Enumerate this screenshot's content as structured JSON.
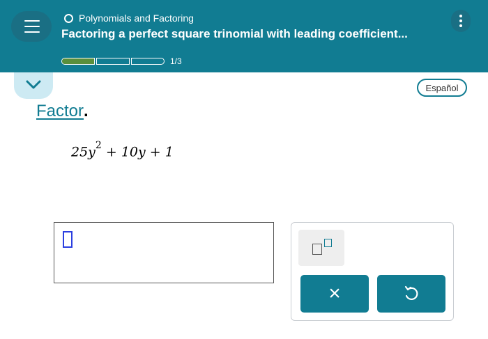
{
  "header": {
    "topic": "Polynomials and Factoring",
    "title": "Factoring a perfect square trinomial with leading coefficient...",
    "progress": {
      "text": "1/3",
      "segments": 3,
      "filled_fraction_of_first": 1.0
    }
  },
  "language_button": "Español",
  "problem": {
    "instruction": "Factor",
    "period": ".",
    "expression": {
      "part1": "25y",
      "exponent": "2",
      "part2": " + 10y + 1"
    }
  },
  "keypad": {
    "superscript_key": "superscript-template-icon",
    "clear_label": "×",
    "undo_icon": "undo-icon"
  },
  "colors": {
    "brand": "#117c92",
    "progress_fill": "#5a8f3c",
    "cursor": "#2b3fe0",
    "tab": "#cdeaf3"
  }
}
